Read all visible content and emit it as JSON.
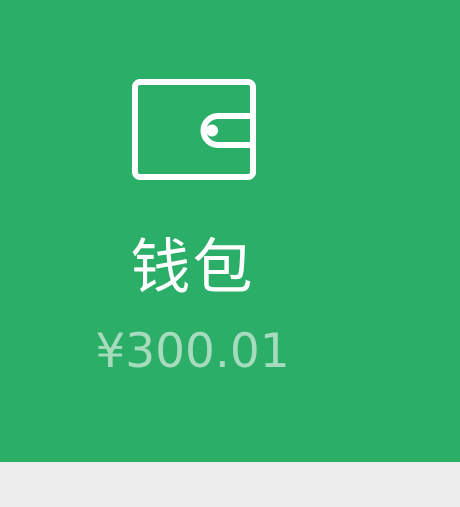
{
  "wallet": {
    "icon": "wallet-icon",
    "title": "钱包",
    "balance": "¥300.01"
  },
  "colors": {
    "card_background": "#2bae67",
    "title": "#ffffff",
    "balance": "#a7dbbd",
    "icon": "#ffffff",
    "page_background": "#ededed"
  }
}
